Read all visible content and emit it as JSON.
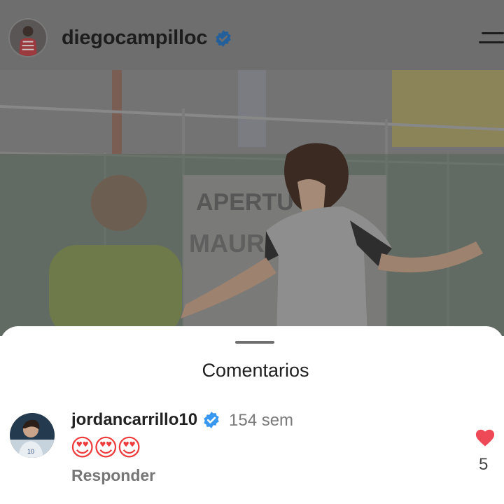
{
  "header": {
    "username": "diegocampilloc",
    "verified": true,
    "avatar_icon": "profile-avatar",
    "menu_icon": "hamburger-menu-icon"
  },
  "post": {
    "media": "photo of a soccer player in a grey jersey on a field"
  },
  "comments_sheet": {
    "title": "Comentarios",
    "comments": [
      {
        "username": "jordancarrillo10",
        "verified": true,
        "time": "154 sem",
        "text": "😍😍😍",
        "reply_label": "Responder",
        "likes": "5",
        "liked": true
      }
    ]
  },
  "colors": {
    "like_red": "#ed4956",
    "verified_blue": "#3897f0",
    "dim_overlay": "#6e6e6e"
  }
}
